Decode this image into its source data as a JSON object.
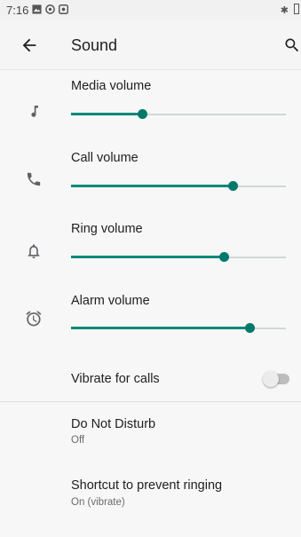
{
  "status_bar": {
    "time": "7:16",
    "icons": [
      "gallery-icon",
      "settings-status-icon",
      "app-status-icon"
    ],
    "right_icons": [
      "bluetooth-icon",
      "battery-icon"
    ]
  },
  "app_bar": {
    "title": "Sound",
    "back_icon": "back-arrow-icon",
    "search_icon": "search-icon"
  },
  "volume_sliders": [
    {
      "label": "Media volume",
      "icon": "music-note-icon",
      "level": 0.33
    },
    {
      "label": "Call volume",
      "icon": "phone-icon",
      "level": 0.75
    },
    {
      "label": "Ring volume",
      "icon": "bell-icon",
      "level": 0.71
    },
    {
      "label": "Alarm volume",
      "icon": "alarm-clock-icon",
      "level": 0.83
    }
  ],
  "vibrate_for_calls": {
    "label": "Vibrate for calls",
    "enabled": false
  },
  "do_not_disturb": {
    "title": "Do Not Disturb",
    "status": "Off"
  },
  "shortcut_prevent_ringing": {
    "title": "Shortcut to prevent ringing",
    "status": "On (vibrate)"
  },
  "colors": {
    "accent": "#00897b",
    "accent_dark": "#00796b"
  }
}
